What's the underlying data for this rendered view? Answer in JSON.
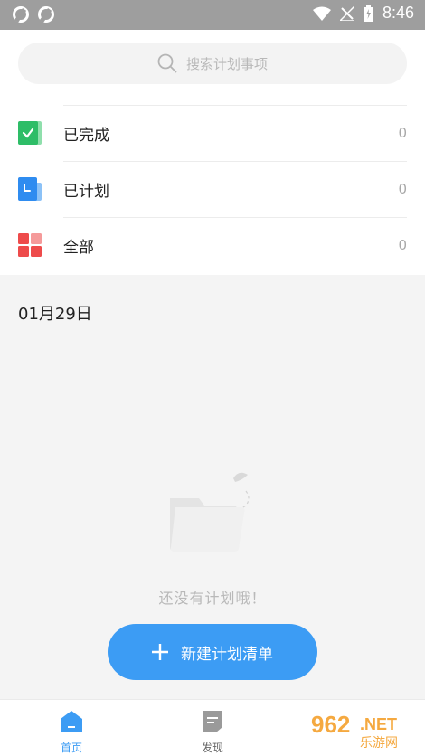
{
  "status_bar": {
    "time": "8:46"
  },
  "search": {
    "placeholder": "搜索计划事项"
  },
  "categories": [
    {
      "label": "已完成",
      "count": "0",
      "color": "#2ebd67",
      "icon": "checkbox-icon"
    },
    {
      "label": "已计划",
      "count": "0",
      "color": "#2f8cf0",
      "icon": "calendar-icon"
    },
    {
      "label": "全部",
      "count": "0",
      "color": "#ee4b4b",
      "icon": "grid-icon"
    }
  ],
  "date_header": "01月29日",
  "empty_state": {
    "text": "还没有计划哦！"
  },
  "new_button": {
    "label": "新建计划清单"
  },
  "tabs": [
    {
      "label": "首页",
      "active": true,
      "color": "#3c9cf4"
    },
    {
      "label": "发现",
      "active": false,
      "color": "#666666"
    }
  ],
  "watermark": {
    "text": "962.NET",
    "sub": "乐游网"
  }
}
